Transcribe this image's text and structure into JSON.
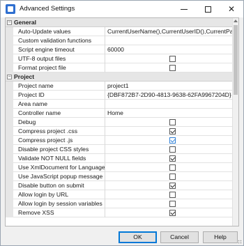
{
  "window": {
    "title": "Advanced Settings"
  },
  "titlebar": {
    "minimize": "—",
    "maximize": "☐",
    "close": "✕"
  },
  "categories": [
    {
      "label": "General",
      "toggle": "−",
      "rows": [
        {
          "name": "Auto-Update values",
          "value": "CurrentUserName(),CurrentUserID(),CurrentParentUse",
          "type": "text"
        },
        {
          "name": "Custom validation functions",
          "value": "",
          "type": "text"
        },
        {
          "name": "Script engine timeout",
          "value": "60000",
          "type": "text"
        },
        {
          "name": "UTF-8 output files",
          "type": "checkbox",
          "checked": false
        },
        {
          "name": "Format project file",
          "type": "checkbox",
          "checked": false
        }
      ]
    },
    {
      "label": "Project",
      "toggle": "−",
      "rows": [
        {
          "name": "Project name",
          "value": "project1",
          "type": "text"
        },
        {
          "name": "Project ID",
          "value": "{DBF872B7-2D90-4813-9638-62FA9967204D}",
          "type": "text"
        },
        {
          "name": "Area name",
          "value": "",
          "type": "text"
        },
        {
          "name": "Controller name",
          "value": "Home",
          "type": "text"
        },
        {
          "name": "Debug",
          "type": "checkbox",
          "checked": false
        },
        {
          "name": "Compress project .css",
          "type": "checkbox",
          "checked": true
        },
        {
          "name": "Compress project .js",
          "type": "checkbox",
          "checked": true,
          "accent": true
        },
        {
          "name": "Disable project CSS styles",
          "type": "checkbox",
          "checked": false
        },
        {
          "name": "Validate NOT NULL fields",
          "type": "checkbox",
          "checked": true
        },
        {
          "name": "Use XmlDocument for Language ob",
          "type": "checkbox",
          "checked": false
        },
        {
          "name": "Use JavaScript popup message",
          "type": "checkbox",
          "checked": false
        },
        {
          "name": "Disable button on submit",
          "type": "checkbox",
          "checked": true
        },
        {
          "name": "Allow login by URL",
          "type": "checkbox",
          "checked": false
        },
        {
          "name": "Allow login by session variables",
          "type": "checkbox",
          "checked": false
        },
        {
          "name": "Remove XSS",
          "type": "checkbox",
          "checked": true
        }
      ]
    }
  ],
  "buttons": {
    "ok": "OK",
    "cancel": "Cancel",
    "help": "Help"
  },
  "colors": {
    "accent": "#0078d7",
    "selection": "#3399ff"
  }
}
